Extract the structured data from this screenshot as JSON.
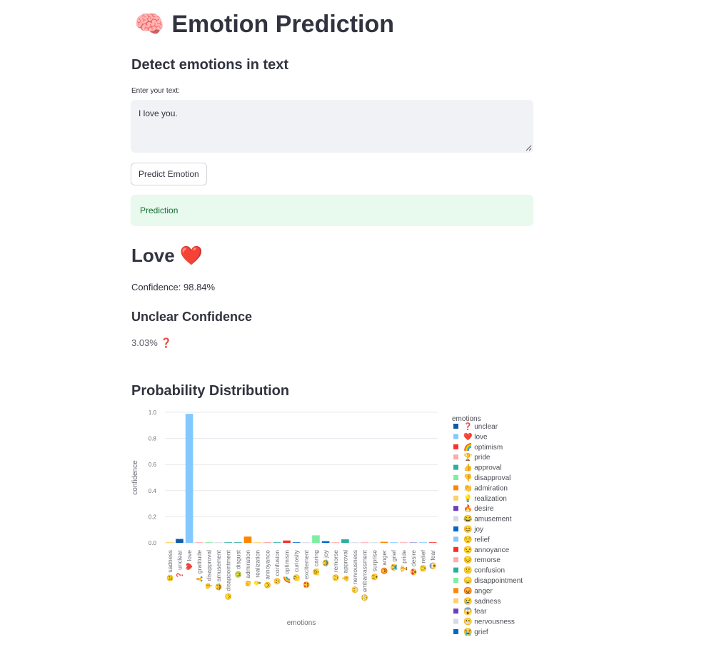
{
  "header": {
    "icon": "🧠",
    "title": "Emotion Prediction"
  },
  "subtitle": "Detect emotions in text",
  "input": {
    "label": "Enter your text:",
    "value": "I love you."
  },
  "button": {
    "label": "Predict Emotion"
  },
  "prediction_box": {
    "label": "Prediction"
  },
  "result": {
    "label": "Love",
    "emoji": "❤️",
    "confidence_text": "Confidence: 98.84%"
  },
  "unclear": {
    "title": "Unclear Confidence",
    "value": "3.03%",
    "icon": "❓"
  },
  "chart_section": {
    "title": "Probability Distribution"
  },
  "chart_data": {
    "type": "bar",
    "xlabel": "emotions",
    "ylabel": "confidence",
    "ylim": [
      0,
      1.0
    ],
    "yticks": [
      "0.0",
      "0.2",
      "0.4",
      "0.6",
      "0.8",
      "1.0"
    ],
    "grid": true,
    "legend_title": "emotions",
    "legend_position": "right",
    "categories": [
      {
        "name": "sadness",
        "emoji": "😢",
        "value": 0.005,
        "color": "#fdd36a"
      },
      {
        "name": "unclear",
        "emoji": "❓",
        "value": 0.03,
        "color": "#0e5baa"
      },
      {
        "name": "love",
        "emoji": "❤️",
        "value": 0.9884,
        "color": "#83c9ff"
      },
      {
        "name": "gratitude",
        "emoji": "🙏",
        "value": 0.003,
        "color": "#ffabab"
      },
      {
        "name": "disapproval",
        "emoji": "👎",
        "value": 0.002,
        "color": "#7defa1"
      },
      {
        "name": "amusement",
        "emoji": "😂",
        "value": 0.002,
        "color": "#d5dae5"
      },
      {
        "name": "disappointment",
        "emoji": "😞",
        "value": 0.002,
        "color": "#29b09d"
      },
      {
        "name": "disgust",
        "emoji": "🤢",
        "value": 0.001,
        "color": "#29b09d"
      },
      {
        "name": "admiration",
        "emoji": "👏",
        "value": 0.048,
        "color": "#ff8700"
      },
      {
        "name": "realization",
        "emoji": "💡",
        "value": 0.004,
        "color": "#ffd16a"
      },
      {
        "name": "annoyance",
        "emoji": "😒",
        "value": 0.006,
        "color": "#ffabab"
      },
      {
        "name": "confusion",
        "emoji": "😕",
        "value": 0.004,
        "color": "#29b09d"
      },
      {
        "name": "optimism",
        "emoji": "🌈",
        "value": 0.018,
        "color": "#ff2b2b"
      },
      {
        "name": "curiosity",
        "emoji": "🤔",
        "value": 0.003,
        "color": "#0068c9"
      },
      {
        "name": "excitement",
        "emoji": "🤩",
        "value": 0.002,
        "color": "#d5dae5"
      },
      {
        "name": "caring",
        "emoji": "🤗",
        "value": 0.058,
        "color": "#7defa1"
      },
      {
        "name": "joy",
        "emoji": "😂",
        "value": 0.013,
        "color": "#0068c9"
      },
      {
        "name": "remorse",
        "emoji": "😔",
        "value": 0.003,
        "color": "#ffabab"
      },
      {
        "name": "approval",
        "emoji": "👍",
        "value": 0.027,
        "color": "#29b09d"
      },
      {
        "name": "nervousness",
        "emoji": "😬",
        "value": 0.002,
        "color": "#d5dae5"
      },
      {
        "name": "embarrassment",
        "emoji": "😳",
        "value": 0.001,
        "color": "#ffabab"
      },
      {
        "name": "surprise",
        "emoji": "😲",
        "value": 0.002,
        "color": "#d5dae5"
      },
      {
        "name": "anger",
        "emoji": "😡",
        "value": 0.008,
        "color": "#ff8700"
      },
      {
        "name": "grief",
        "emoji": "😭",
        "value": 0.002,
        "color": "#83c9ff"
      },
      {
        "name": "pride",
        "emoji": "🏆",
        "value": 0.002,
        "color": "#ffabab"
      },
      {
        "name": "desire",
        "emoji": "😍",
        "value": 0.004,
        "color": "#a0a0d8"
      },
      {
        "name": "relief",
        "emoji": "😌",
        "value": 0.002,
        "color": "#83c9ff"
      },
      {
        "name": "fear",
        "emoji": "😱",
        "value": 0.002,
        "color": "#ff2b2b"
      }
    ],
    "legend": [
      {
        "name": "unclear",
        "emoji": "❓",
        "color": "#0e5baa"
      },
      {
        "name": "love",
        "emoji": "❤️",
        "color": "#83c9ff"
      },
      {
        "name": "optimism",
        "emoji": "🌈",
        "color": "#ff2b2b"
      },
      {
        "name": "pride",
        "emoji": "🏆",
        "color": "#ffabab"
      },
      {
        "name": "approval",
        "emoji": "👍",
        "color": "#29b09d"
      },
      {
        "name": "disapproval",
        "emoji": "👎",
        "color": "#7defa1"
      },
      {
        "name": "admiration",
        "emoji": "👏",
        "color": "#ff8700"
      },
      {
        "name": "realization",
        "emoji": "💡",
        "color": "#ffd16a"
      },
      {
        "name": "desire",
        "emoji": "🔥",
        "color": "#6d3fc0"
      },
      {
        "name": "amusement",
        "emoji": "😂",
        "color": "#d5dae5"
      },
      {
        "name": "joy",
        "emoji": "😊",
        "color": "#0068c9"
      },
      {
        "name": "relief",
        "emoji": "😌",
        "color": "#83c9ff"
      },
      {
        "name": "annoyance",
        "emoji": "😒",
        "color": "#ff2b2b"
      },
      {
        "name": "remorse",
        "emoji": "😔",
        "color": "#ffabab"
      },
      {
        "name": "confusion",
        "emoji": "😕",
        "color": "#29b09d"
      },
      {
        "name": "disappointment",
        "emoji": "😞",
        "color": "#7defa1"
      },
      {
        "name": "anger",
        "emoji": "😡",
        "color": "#ff8700"
      },
      {
        "name": "sadness",
        "emoji": "😢",
        "color": "#ffd16a"
      },
      {
        "name": "fear",
        "emoji": "😱",
        "color": "#6d3fc0"
      },
      {
        "name": "nervousness",
        "emoji": "😬",
        "color": "#d5dae5"
      },
      {
        "name": "grief",
        "emoji": "😭",
        "color": "#0068c9"
      }
    ]
  }
}
